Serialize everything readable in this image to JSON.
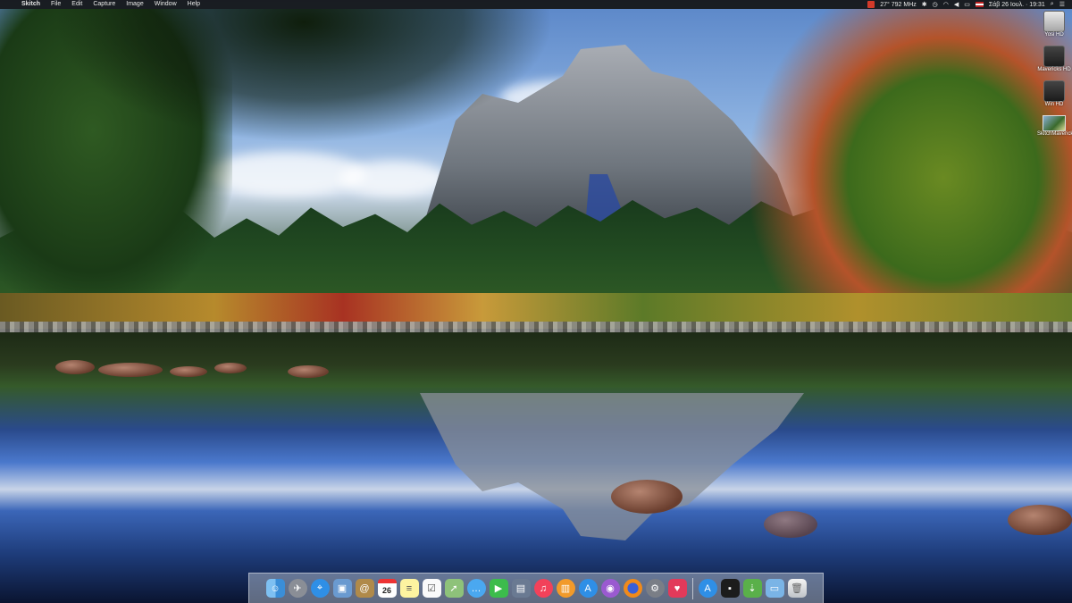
{
  "menubar": {
    "app_name": "Skitch",
    "menus": [
      "File",
      "Edit",
      "Capture",
      "Image",
      "Window",
      "Help"
    ],
    "cpu_status": "27° 792 MHz",
    "datetime": "Σάβ 26 Ιουλ. · 19:31"
  },
  "desktop_icons": [
    {
      "label": "Yosi HD",
      "icon": "hard-drive-icon"
    },
    {
      "label": "Mavericks HD",
      "icon": "hard-drive-icon"
    },
    {
      "label": "Win HD",
      "icon": "hard-drive-icon"
    },
    {
      "label": "SkitchMavericks.jpg",
      "icon": "image-file-icon"
    }
  ],
  "dock": {
    "calendar_day": "26",
    "apps": [
      "finder-icon",
      "launchpad-icon",
      "safari-icon",
      "preview-icon",
      "contacts-icon",
      "calendar-icon",
      "notes-icon",
      "reminders-icon",
      "maps-icon",
      "messages-icon",
      "facetime-icon",
      "photo-booth-icon",
      "itunes-icon",
      "ibooks-icon",
      "app-store-icon",
      "instruments-icon",
      "firefox-icon",
      "system-preferences-icon",
      "skitch-icon",
      "app-store-blue-icon",
      "terminal-icon",
      "archive-utility-icon",
      "downloads-folder-icon",
      "trash-icon"
    ]
  }
}
